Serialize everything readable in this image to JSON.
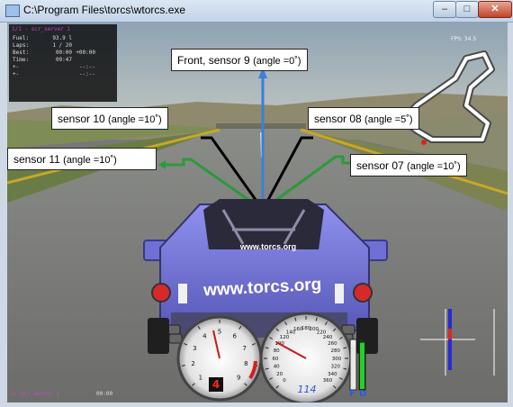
{
  "window": {
    "title": "C:\\Program Files\\torcs\\wtorcs.exe",
    "minimize_glyph": "–",
    "maximize_glyph": "□",
    "close_glyph": "✕"
  },
  "hud": {
    "title": "1/1 - scr_server 1",
    "rows": [
      {
        "label": "Fuel:",
        "value": "93.9 l",
        "extra": ""
      },
      {
        "label": "Laps:",
        "value": "1 / 20",
        "extra": ""
      },
      {
        "label": "Best:",
        "value": "00:00",
        "extra": "+00:00"
      },
      {
        "label": "Time:",
        "value": "09:47",
        "extra": ""
      },
      {
        "label": "+-",
        "value": "",
        "extra": "--:--"
      },
      {
        "label": "+-",
        "value": "",
        "extra": "--:--"
      }
    ],
    "fps": "FPS: 34.5",
    "status_left": "1: scr_server 1",
    "status_time": "00:00"
  },
  "sensors": {
    "front": {
      "prefix": "Front, ",
      "name": "sensor 9",
      "angle": "(angle =0˚)"
    },
    "s10": {
      "name": "sensor  10",
      "angle": "(angle =10˚)"
    },
    "s08": {
      "name": "sensor 08",
      "angle": "(angle =5˚)"
    },
    "s11": {
      "name": "sensor  11",
      "angle": "(angle =10˚)"
    },
    "s07": {
      "name": "sensor  07",
      "angle": "(angle =10˚)"
    }
  },
  "car": {
    "windshield_text": "www.torcs.org",
    "rear_text": "www.torcs.org"
  },
  "dashboard": {
    "gear": "4",
    "speed": "114",
    "rpm_ticks": [
      "1",
      "2",
      "3",
      "4",
      "5",
      "6",
      "7",
      "8",
      "9"
    ],
    "rpm_unit": "x1000\nr/min",
    "speed_ticks": [
      "0",
      "20",
      "40",
      "60",
      "80",
      "100",
      "120",
      "140",
      "160",
      "180",
      "200",
      "220",
      "240",
      "260",
      "280",
      "300",
      "320",
      "340",
      "360"
    ],
    "speed_unit": "km/h",
    "fuel_label": "F",
    "damage_label": "D",
    "fuel_level": 0.9,
    "damage_level": 0.05
  },
  "colors": {
    "sensor_front": "#3b7fd8",
    "sensor_side": "#2a9a3a",
    "sensor_diag": "#000000",
    "car_body": "#7d7de0",
    "sky": "#a9b8c0",
    "road": "#7a7a7a",
    "grass": "#5c8a3c"
  }
}
